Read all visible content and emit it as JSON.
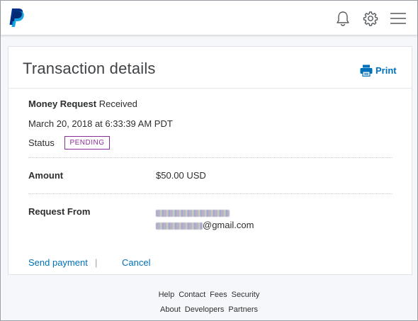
{
  "header": {
    "brand": "PayPal",
    "icons": [
      "bell-icon",
      "gear-icon",
      "menu-icon"
    ]
  },
  "card": {
    "title": "Transaction details",
    "print_label": "Print",
    "type_label": "Money Request",
    "type_status": "Received",
    "datetime": "March 20, 2018 at 6:33:39 AM PDT",
    "status_label": "Status",
    "status_value": "PENDING",
    "amount_label": "Amount",
    "amount_value": "$50.00 USD",
    "request_from_label": "Request From",
    "email_suffix": "@gmail.com",
    "send_payment_label": "Send payment",
    "separator": "|",
    "cancel_label": "Cancel"
  },
  "footer": {
    "row1": [
      "Help",
      "Contact",
      "Fees",
      "Security"
    ],
    "row2": [
      "About",
      "Developers",
      "Partners"
    ]
  },
  "colors": {
    "link": "#0070ba",
    "pending": "#8a2c9a",
    "brand_dark": "#003087",
    "brand_light": "#009cde"
  }
}
